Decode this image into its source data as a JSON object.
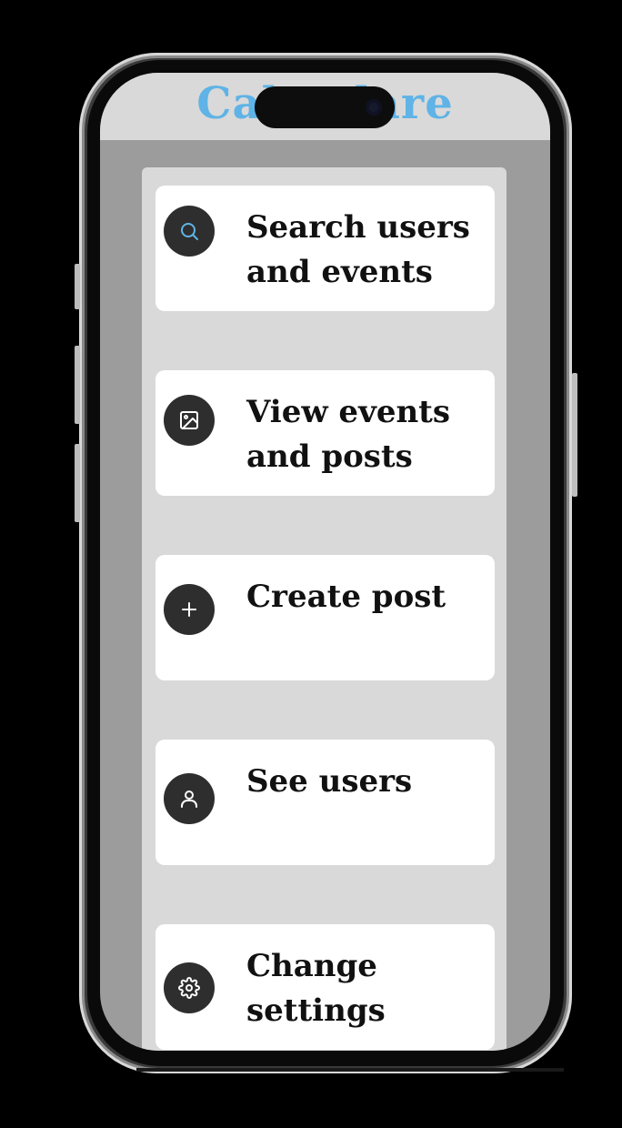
{
  "app": {
    "title": "Calendare"
  },
  "menu": {
    "items": [
      {
        "label": "Search users and events",
        "icon": "search-icon",
        "icon_color": "#5fb3e6"
      },
      {
        "label": "View events and posts",
        "icon": "image-icon",
        "icon_color": "#ffffff"
      },
      {
        "label": "Create post",
        "icon": "plus-icon",
        "icon_color": "#ffffff"
      },
      {
        "label": "See users",
        "icon": "user-icon",
        "icon_color": "#ffffff"
      },
      {
        "label": "Change settings",
        "icon": "gear-icon",
        "icon_color": "#ffffff"
      }
    ]
  },
  "colors": {
    "accent": "#5fb3e6",
    "icon_bg": "#2e2e2e",
    "panel_bg": "#d9d9d9",
    "screen_bg": "#9c9c9c"
  }
}
